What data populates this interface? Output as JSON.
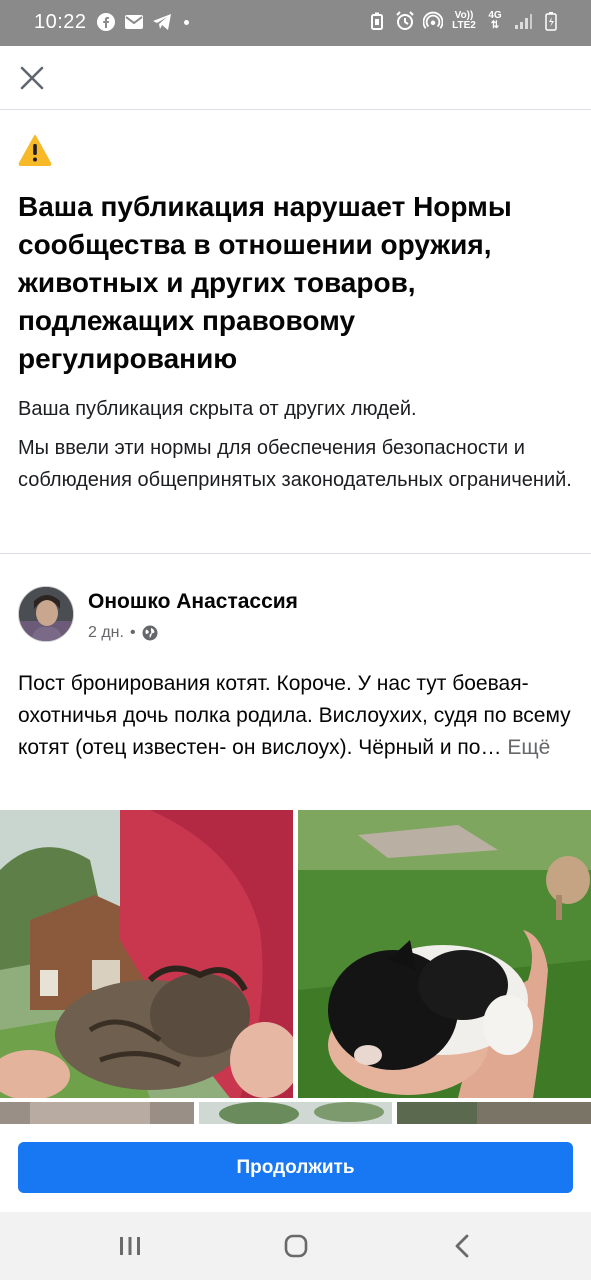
{
  "status_bar": {
    "time": "10:22",
    "left_icons": [
      "facebook-icon",
      "mail-icon",
      "telegram-icon"
    ],
    "right_icons": [
      "battery-saver-icon",
      "alarm-icon",
      "hotspot-icon",
      "volte-icon",
      "4g-icon",
      "signal-icon",
      "battery-charging-icon"
    ],
    "volte_label_top": "Vo))",
    "volte_label_bottom": "LTE2",
    "net_label": "4G"
  },
  "header": {
    "close_icon": "close-icon"
  },
  "warning": {
    "icon": "warning-icon",
    "icon_color": "#f7b928",
    "title": "Ваша публикация нарушает Нормы сообщества в отношении оружия, животных и других товаров, подлежащих правовому регулированию",
    "hidden_text": "Ваша публикация скрыта от других людей.",
    "explanation": "Мы ввели эти нормы для обеспечения безопасности и соблюдения общепринятых законодательных ограничений."
  },
  "post": {
    "author": "Оношко Анастассия",
    "time": "2 дн.",
    "separator": "•",
    "privacy_icon": "globe-icon",
    "text": "Пост бронирования котят. Короче. У нас тут боевая-охотничья дочь полка родила. Вислоухих, судя по всему котят (отец известен- он вислоух). Чёрный и по…",
    "more_label": "Ещё"
  },
  "actions": {
    "continue_label": "Продолжить",
    "accent": "#1877f2"
  },
  "nav_bar": {
    "recents_icon": "recents-icon",
    "home_icon": "home-icon",
    "back_icon": "back-icon"
  }
}
